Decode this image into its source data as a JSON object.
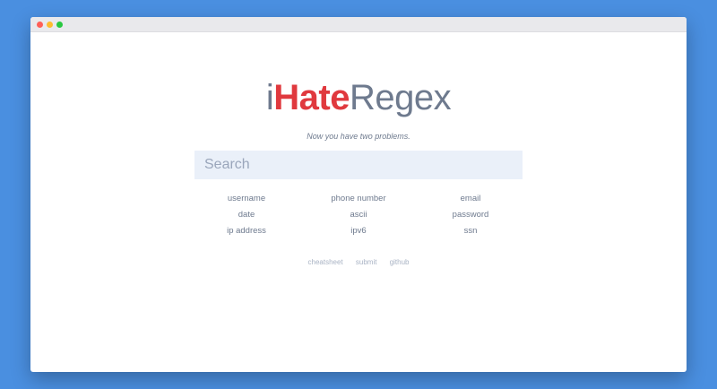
{
  "window": {
    "controls": [
      "close",
      "minimize",
      "maximize"
    ]
  },
  "logo": {
    "prefix": "i",
    "accent": "Hate",
    "suffix": "Regex"
  },
  "tagline": "Now you have two problems.",
  "search": {
    "placeholder": "Search",
    "value": ""
  },
  "categories": [
    "username",
    "phone number",
    "email",
    "date",
    "ascii",
    "password",
    "ip address",
    "ipv6",
    "ssn"
  ],
  "footer": {
    "links": [
      "cheatsheet",
      "submit",
      "github"
    ]
  },
  "colors": {
    "accent": "#e0393e",
    "text": "#6e7a8e",
    "search_bg": "#eaf0f9",
    "page_bg": "#4a8fe0"
  }
}
